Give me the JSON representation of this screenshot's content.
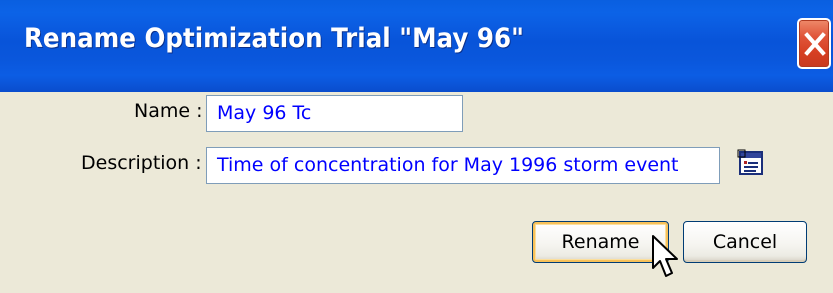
{
  "dialog": {
    "title": "Rename Optimization Trial \"May 96\"",
    "close_icon": "close-icon"
  },
  "form": {
    "name_label": "Name :",
    "name_value": "May 96 Tc",
    "description_label": "Description :",
    "description_value": "Time of concentration for May 1996 storm event",
    "browse_icon": "text-editor-icon"
  },
  "buttons": {
    "rename_label": "Rename",
    "cancel_label": "Cancel"
  },
  "colors": {
    "titlebar": "#0a57dc",
    "dialog_background": "#ece9d8",
    "field_text": "#0000ff",
    "field_border": "#7f9db9",
    "default_button_focus": "#f7c15a",
    "close_button": "#d63f22"
  }
}
